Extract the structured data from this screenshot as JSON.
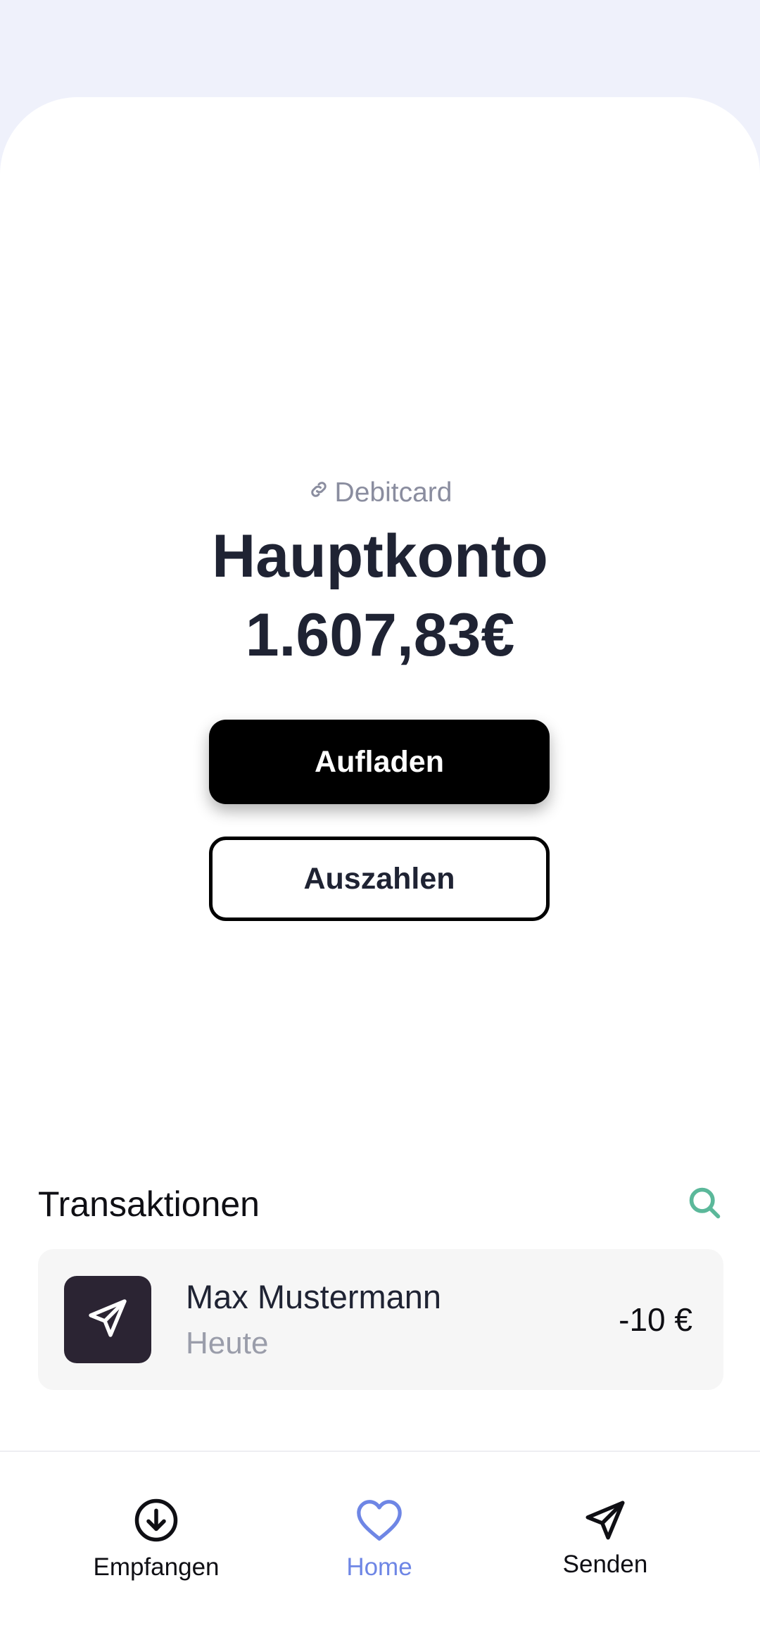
{
  "account": {
    "type_label": "Debitcard",
    "type_icon": "link-icon",
    "name": "Hauptkonto",
    "balance": "1.607,83€"
  },
  "actions": {
    "topup_label": "Aufladen",
    "withdraw_label": "Auszahlen"
  },
  "transactions": {
    "title": "Transaktionen",
    "search_icon": "search-icon",
    "accent_color": "#5bb89a",
    "items": [
      {
        "icon": "send-icon",
        "name": "Max Mustermann",
        "date": "Heute",
        "amount": "-10 €"
      }
    ]
  },
  "nav": {
    "active_color": "#6e86e5",
    "items": [
      {
        "label": "Empfangen",
        "icon": "download-circle-icon",
        "active": false
      },
      {
        "label": "Home",
        "icon": "heart-icon",
        "active": true
      },
      {
        "label": "Senden",
        "icon": "send-icon",
        "active": false
      }
    ]
  }
}
